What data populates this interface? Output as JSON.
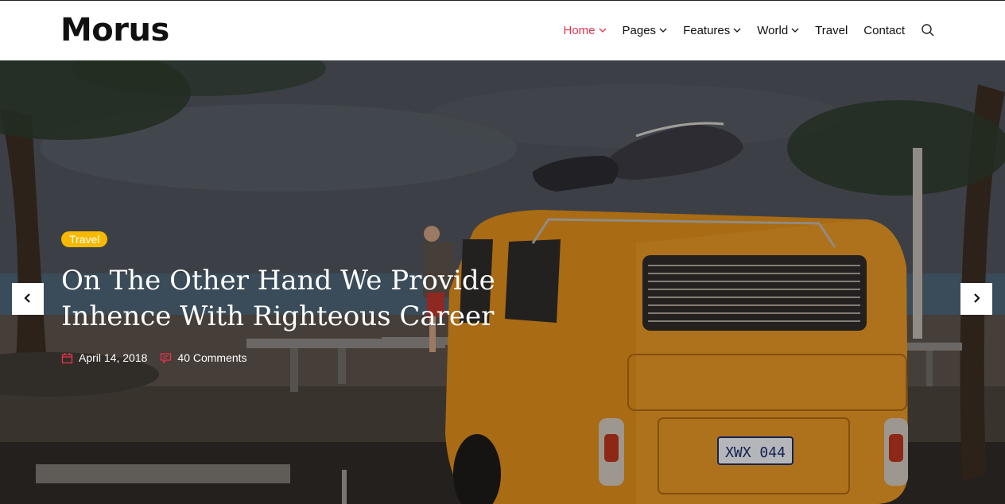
{
  "header": {
    "logo": "Morus",
    "nav": [
      {
        "label": "Home",
        "active": true,
        "dropdown": true
      },
      {
        "label": "Pages",
        "active": false,
        "dropdown": true
      },
      {
        "label": "Features",
        "active": false,
        "dropdown": true
      },
      {
        "label": "World",
        "active": false,
        "dropdown": true
      },
      {
        "label": "Travel",
        "active": false,
        "dropdown": false
      },
      {
        "label": "Contact",
        "active": false,
        "dropdown": false
      }
    ],
    "search_icon": "search-icon"
  },
  "hero": {
    "category": "Travel",
    "title": "On The Other Hand We Provide Inhence With Righteous Career",
    "date": "April 14, 2018",
    "comments": "40 Comments",
    "plate": "XWX 044",
    "prev_icon": "chevron-left-icon",
    "next_icon": "chevron-right-icon"
  },
  "colors": {
    "accent": "#e8334f",
    "badge": "#f7b900",
    "van": "#d9891a"
  }
}
